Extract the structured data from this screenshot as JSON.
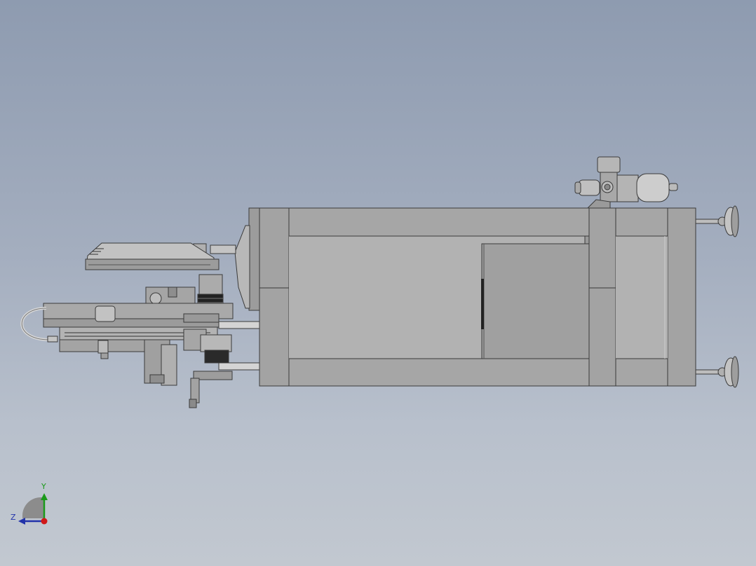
{
  "viewport": {
    "background_top": "#8e9bb0",
    "background_bottom": "#c2c8d0"
  },
  "model": {
    "name": "mechanical-assembly",
    "colors": {
      "body": "#a9a9a9",
      "body_light": "#bdbdbd",
      "body_dark": "#8a8a8a",
      "edge": "#3a3a3a"
    }
  },
  "triad": {
    "y_label": "Y",
    "z_label": "Z",
    "y_color": "#1a9a1a",
    "z_color": "#2233aa",
    "origin_color": "#d01818"
  }
}
